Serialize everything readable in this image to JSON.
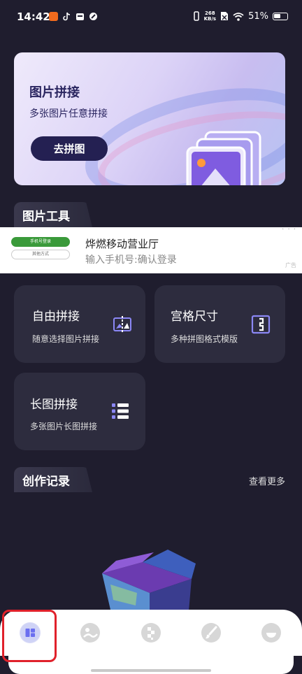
{
  "status_bar": {
    "time": "14:42",
    "speed_value": "268",
    "speed_unit": "KB/s",
    "battery": "51%"
  },
  "banner": {
    "title": "图片拼接",
    "subtitle": "多张图片任意拼接",
    "button": "去拼图"
  },
  "sections": {
    "tools_title": "图片工具",
    "records_title": "创作记录",
    "more_link": "查看更多"
  },
  "ad": {
    "thumb_btn_primary": "手机号登录",
    "thumb_btn_secondary": "其他方式",
    "title": "烨燃移动营业厅",
    "subtitle": "输入手机号:确认登录",
    "tag": "广告",
    "menu": "· · ·"
  },
  "tools": [
    {
      "title": "自由拼接",
      "subtitle": "随意选择图片拼接",
      "icon": "free-collage-icon"
    },
    {
      "title": "宫格尺寸",
      "subtitle": "多种拼图格式模版",
      "icon": "grid-size-icon"
    },
    {
      "title": "长图拼接",
      "subtitle": "多张图片长图拼接",
      "icon": "long-collage-icon"
    }
  ],
  "bottom_nav": [
    {
      "icon": "home-grid-icon",
      "active": true
    },
    {
      "icon": "photo-edit-icon",
      "active": false
    },
    {
      "icon": "mosaic-icon",
      "active": false
    },
    {
      "icon": "brush-icon",
      "active": false
    },
    {
      "icon": "profile-icon",
      "active": false
    }
  ],
  "colors": {
    "background": "#1f1d2e",
    "card": "#2d2c3e",
    "accent": "#7d79f0",
    "banner_button": "#242052",
    "highlight": "#e0212b"
  }
}
